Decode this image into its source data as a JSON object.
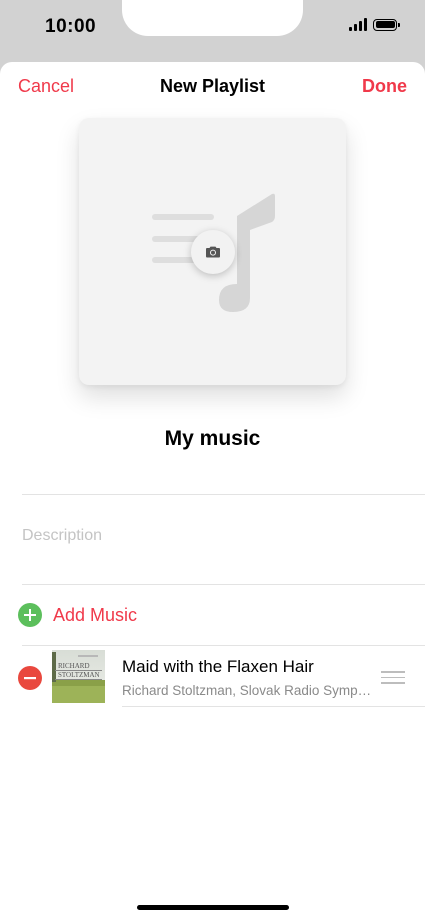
{
  "status_bar": {
    "time": "10:00"
  },
  "nav": {
    "cancel_label": "Cancel",
    "title": "New Playlist",
    "done_label": "Done"
  },
  "artwork": {
    "icon": "music-note-icon",
    "camera_icon": "camera-icon"
  },
  "playlist": {
    "name": "My music",
    "description_placeholder": "Description",
    "description_value": ""
  },
  "add_music": {
    "label": "Add Music",
    "icon": "plus-circle-icon"
  },
  "tracks": [
    {
      "title": "Maid with the Flaxen Hair",
      "artist": "Richard Stoltzman, Slovak Radio Symphony Orchestra",
      "artwork_text_line1": "RICHARD",
      "artwork_text_line2": "STOLTZMAN"
    }
  ],
  "colors": {
    "accent": "#f0394a",
    "add_green": "#5cbf5c",
    "remove_red": "#e9483e",
    "placeholder_gray": "#c4c4c4",
    "secondary_text": "#8a8a8a"
  }
}
